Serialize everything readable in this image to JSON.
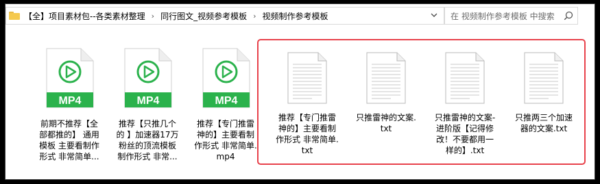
{
  "window_title": "",
  "address_bar": {
    "crumbs": [
      "【全】项目素材包--各类素材整理",
      "同行图文_视频参考模板",
      "视频制作参考模板"
    ],
    "separator": "›"
  },
  "search": {
    "placeholder": "在 视频制作参考模板 中搜索"
  },
  "files": [
    {
      "type": "mp4",
      "badge": "MP4",
      "lines": [
        "前期不推荐【全",
        "部都推的】 通用",
        "模板 主要看制作",
        "形式 非常简单..."
      ]
    },
    {
      "type": "mp4",
      "badge": "MP4",
      "lines": [
        "推荐【只推几个",
        "的 】加速器17万",
        "粉丝的顶流模板",
        "制作形式 非常..."
      ]
    },
    {
      "type": "mp4",
      "badge": "MP4",
      "lines": [
        "推荐【专门推雷",
        "神的】主要看制",
        "作形式 非常简单.",
        "mp4"
      ]
    },
    {
      "type": "txt",
      "lines": [
        "推荐【专门推雷",
        "神的】主要看制",
        "作形式 非常简单.",
        "txt"
      ]
    },
    {
      "type": "txt",
      "lines": [
        "只推雷神的文案.",
        "txt"
      ]
    },
    {
      "type": "txt",
      "lines": [
        "只推雷神的文案-",
        "进阶版【记得修",
        "改！不要都用一",
        "样的】.txt"
      ]
    },
    {
      "type": "txt",
      "lines": [
        "只推两三个加速",
        "器的文案.txt"
      ]
    }
  ],
  "colors": {
    "mp4_green": "#2bb24c",
    "selection_red": "#e8414a",
    "folder": "#f5c94e"
  },
  "icons": [
    "folder-icon",
    "chevron-down-icon",
    "refresh-icon",
    "search-icon",
    "video-file-icon",
    "text-file-icon"
  ]
}
